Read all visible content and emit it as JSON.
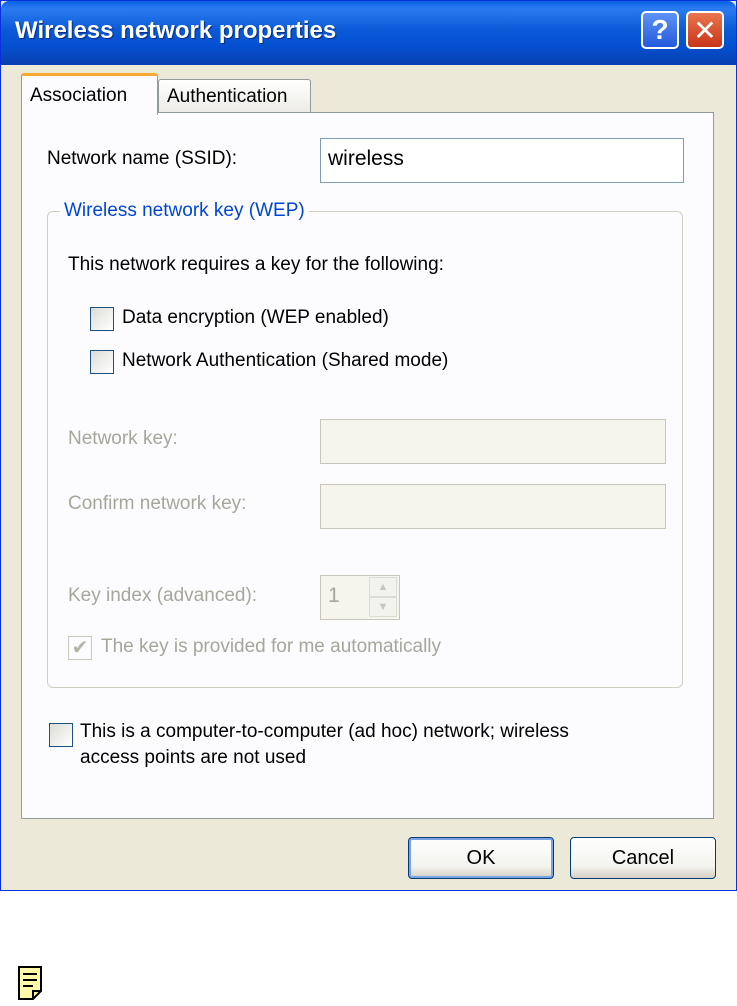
{
  "window": {
    "title": "Wireless network properties",
    "help_glyph": "?",
    "close_glyph": "✕"
  },
  "tabs": [
    {
      "label": "Association",
      "selected": true
    },
    {
      "label": "Authentication",
      "selected": false
    }
  ],
  "association": {
    "ssid_label": "Network name (SSID):",
    "ssid_value": "wireless",
    "wep_group_title": "Wireless network key (WEP)",
    "requires_key_text": "This network requires a key for the following:",
    "data_encryption_label": "Data encryption (WEP enabled)",
    "data_encryption_checked": false,
    "network_auth_label": "Network Authentication (Shared mode)",
    "network_auth_checked": false,
    "network_key_label": "Network key:",
    "network_key_value": "",
    "confirm_key_label": "Confirm network key:",
    "confirm_key_value": "",
    "key_index_label": "Key index (advanced):",
    "key_index_value": "1",
    "auto_key_label": "The key is provided for me automatically",
    "auto_key_checked": true,
    "adhoc_label_line1": "This is a computer-to-computer (ad hoc) network; wireless",
    "adhoc_label_line2": "access points are not used",
    "adhoc_checked": false
  },
  "buttons": {
    "ok": "OK",
    "cancel": "Cancel"
  },
  "icons": {
    "help": "help-icon",
    "close": "close-icon",
    "note": "note-icon",
    "check": "checkmark-icon",
    "spin_up": "arrow-up-icon",
    "spin_down": "arrow-down-icon"
  },
  "colors": {
    "titlebar": "#0a5ad8",
    "group_title": "#0046d5",
    "tab_highlight": "#f7a932",
    "disabled_text": "#a7a69b",
    "dialog_bg": "#ece9d8"
  }
}
